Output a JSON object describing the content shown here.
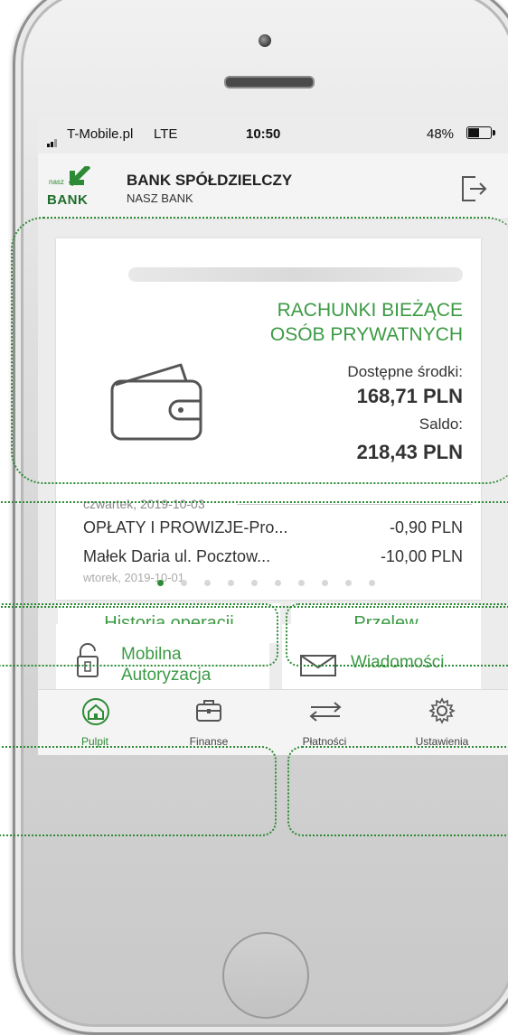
{
  "status_bar": {
    "carrier": "T-Mobile.pl",
    "network": "LTE",
    "time": "10:50",
    "battery": "48%"
  },
  "header": {
    "logo_small": "nasz",
    "logo_word": "BANK",
    "bank_name": "BANK SPÓŁDZIELCZY",
    "bank_subtitle": "NASZ BANK"
  },
  "account": {
    "name_line1": "RACHUNKI BIEŻĄCE",
    "name_line2": "OSÓB PRYWATNYCH",
    "available_label": "Dostępne środki:",
    "available_value": "168,71 PLN",
    "balance_label": "Saldo:",
    "balance_value": "218,43 PLN"
  },
  "history": {
    "date": "czwartek, 2019-10-03",
    "transactions": [
      {
        "title": "OPŁATY I PROWIZJE-Pro...",
        "amount": "-0,90 PLN"
      },
      {
        "title": "Małek Daria  ul. Pocztow...",
        "amount": "-10,00 PLN"
      }
    ],
    "next_date_partial": "wtorek, 2019-10-01"
  },
  "actions": {
    "history_label": "Historia operacji",
    "transfer_label": "Przelew"
  },
  "pager": {
    "count": 10,
    "active_index": 0
  },
  "tiles": {
    "mobile_auth_line1": "Mobilna",
    "mobile_auth_line2": "Autoryzacja",
    "messages": "Wiadomości"
  },
  "tabbar": {
    "items": [
      {
        "label": "Pulpit",
        "icon": "home-icon",
        "active": true
      },
      {
        "label": "Finanse",
        "icon": "briefcase-icon",
        "active": false
      },
      {
        "label": "Płatności",
        "icon": "transfer-arrows-icon",
        "active": false
      },
      {
        "label": "Ustawienia",
        "icon": "gear-icon",
        "active": false
      }
    ]
  },
  "colors": {
    "brand_green": "#2e8b35",
    "accent_green": "#3c9a44",
    "annotation_green": "#2e8b35"
  }
}
